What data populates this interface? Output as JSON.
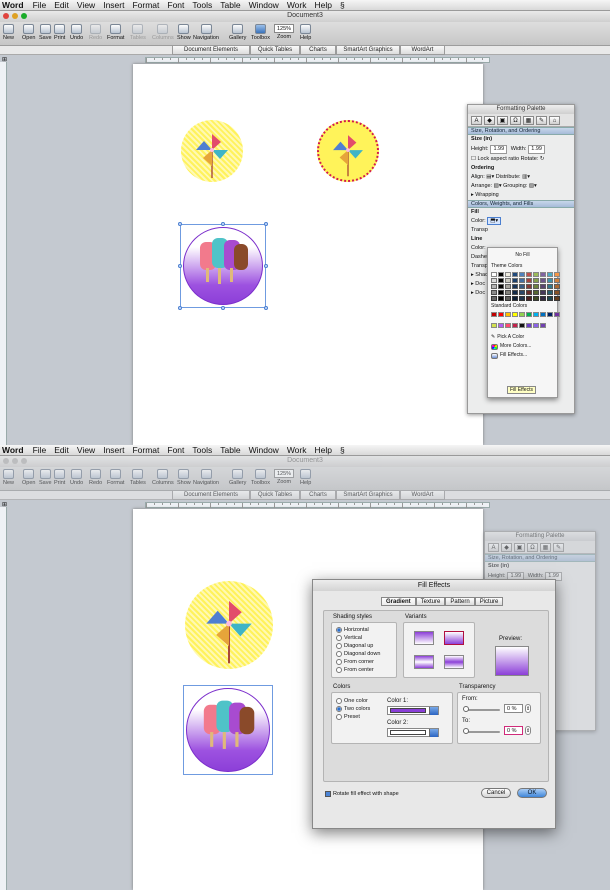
{
  "menubar": {
    "app": "Word",
    "items": [
      "File",
      "Edit",
      "View",
      "Insert",
      "Format",
      "Font",
      "Tools",
      "Table",
      "Window",
      "Work",
      "Help"
    ]
  },
  "window": {
    "title": "Document3"
  },
  "toolbar": {
    "items": [
      {
        "label": "New",
        "icon": "new-doc-icon"
      },
      {
        "label": "Open",
        "icon": "folder-icon"
      },
      {
        "label": "Save",
        "icon": "save-icon"
      },
      {
        "label": "Print",
        "icon": "print-icon"
      },
      {
        "label": "Undo",
        "icon": "undo-icon"
      },
      {
        "label": "Redo",
        "icon": "redo-icon"
      },
      {
        "label": "Format",
        "icon": "format-brush-icon"
      },
      {
        "label": "Tables",
        "icon": "table-icon"
      },
      {
        "label": "Columns",
        "icon": "columns-icon"
      },
      {
        "label": "Show",
        "icon": "pilcrow-icon"
      },
      {
        "label": "Navigation",
        "icon": "navigation-icon"
      },
      {
        "label": "Gallery",
        "icon": "gallery-icon"
      },
      {
        "label": "Toolbox",
        "icon": "toolbox-icon"
      },
      {
        "label": "Zoom",
        "icon": "zoom-icon"
      },
      {
        "label": "Help",
        "icon": "help-icon"
      }
    ],
    "zoom_value": "125%"
  },
  "ribbon": {
    "tabs": [
      "Document Elements",
      "Quick Tables",
      "Charts",
      "SmartArt Graphics",
      "WordArt"
    ]
  },
  "palette": {
    "title": "Formatting Palette",
    "section_size": "Size, Rotation, and Ordering",
    "size_label": "Size (in)",
    "height_label": "Height:",
    "height_value": "1.99",
    "width_label": "Width:",
    "width_value": "1.99",
    "lock_label": "Lock aspect ratio",
    "rotate_label": "Rotate:",
    "ordering_label": "Ordering",
    "align_label": "Align:",
    "distribute_label": "Distribute:",
    "arrange_label": "Arrange:",
    "grouping_label": "Grouping:",
    "wrapping_label": "Wrapping",
    "section_colors": "Colors, Weights, and Fills",
    "fill_label": "Fill",
    "color_label": "Color:",
    "transparency_label": "Transp",
    "line_label": "Line",
    "dashed_label": "Dashe",
    "transp2_label": "Transp",
    "shadow_label": "Shad",
    "doc_label1": "Doc",
    "doc_label2": "Doc"
  },
  "color_popup": {
    "no_fill": "No Fill",
    "theme_colors": "Theme Colors",
    "standard_colors": "Standard Colors",
    "pick_a_color": "Pick A Color",
    "more_colors": "More Colors...",
    "fill_effects": "Fill Effects...",
    "tooltip": "Fill Effects",
    "theme_swatches": [
      "#ffffff",
      "#000000",
      "#eeece1",
      "#1f497d",
      "#4f81bd",
      "#c0504d",
      "#9bbb59",
      "#8064a2",
      "#4bacc6",
      "#f79646"
    ],
    "standard_swatches": [
      "#c00000",
      "#ff0000",
      "#ffc000",
      "#ffff00",
      "#92d050",
      "#00b050",
      "#00b0f0",
      "#0070c0",
      "#002060",
      "#7030a0"
    ],
    "recent_swatches": [
      "#d2e04f",
      "#b05cf0",
      "#ff4a6e",
      "#c0214a",
      "#111111",
      "#6a3bc7",
      "#8b62e8",
      "#7040b0"
    ]
  },
  "dialog": {
    "title": "Fill Effects",
    "tabs": [
      "Gradient",
      "Texture",
      "Pattern",
      "Picture"
    ],
    "shading_label": "Shading styles",
    "shading_options": [
      "Horizontal",
      "Vertical",
      "Diagonal up",
      "Diagonal down",
      "From corner",
      "From center"
    ],
    "variants_label": "Variants",
    "preview_label": "Preview:",
    "colors_label": "Colors",
    "color_options": [
      "One color",
      "Two colors",
      "Preset"
    ],
    "color1_label": "Color 1:",
    "color2_label": "Color 2:",
    "color1_hex": "#8a3fd8",
    "color2_hex": "#ffffff",
    "transparency_label": "Transparency",
    "from_label": "From:",
    "from_value": "0 %",
    "to_label": "To:",
    "to_value": "0 %",
    "rotate_label": "Rotate fill effect with shape",
    "cancel": "Cancel",
    "ok": "OK"
  },
  "colors": {
    "accent": "#3f86d8",
    "purple": "#8c3fd8",
    "yellow": "#fff35a",
    "dot_red": "#d21b4a"
  }
}
